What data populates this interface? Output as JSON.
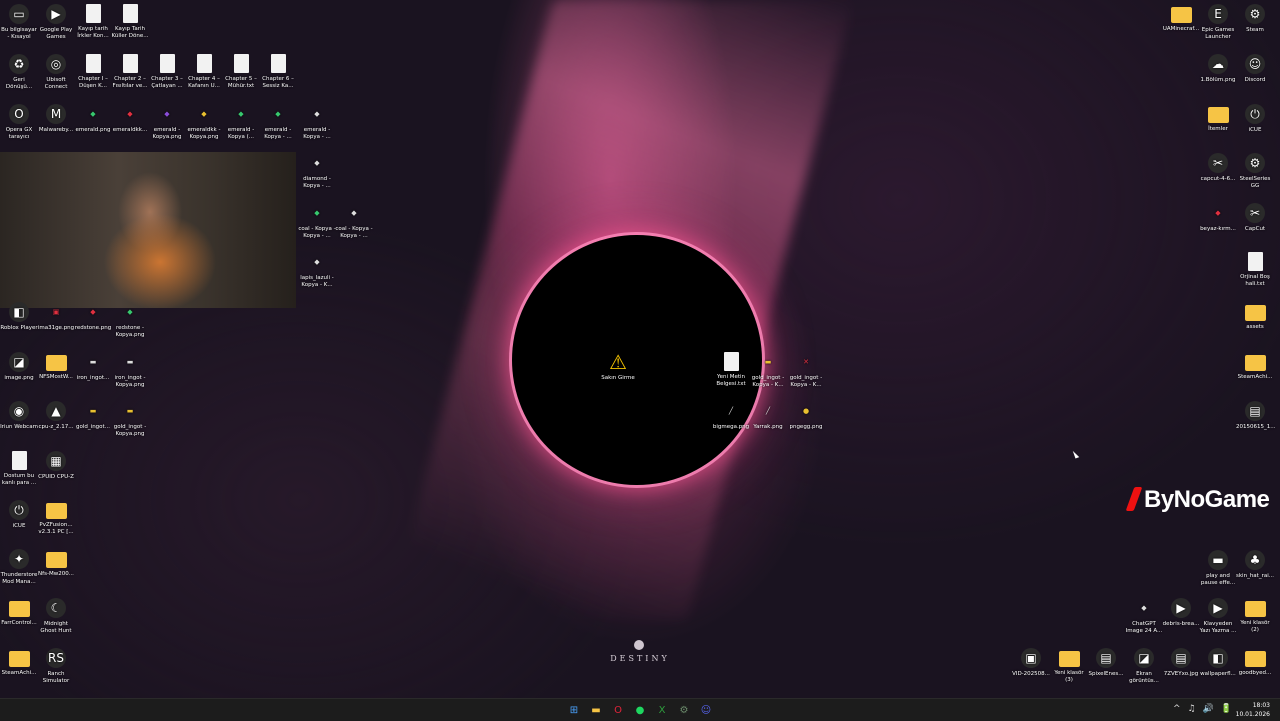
{
  "desktop": {
    "left_icons": [
      {
        "id": "thispc",
        "label": "Bu bilgisayar - Kısayol",
        "kind": "app",
        "glyph": "▭"
      },
      {
        "id": "gplay",
        "label": "Google Play Games",
        "kind": "app",
        "glyph": "▶"
      },
      {
        "id": "kayip1",
        "label": "Kayıp tarih İrkler Kon...",
        "kind": "doc",
        "glyph": ""
      },
      {
        "id": "kayip2",
        "label": "Kayıp Tarih Küller Döne...",
        "kind": "doc",
        "glyph": ""
      },
      {
        "id": "recycle",
        "label": "Geri Dönüşü...",
        "kind": "app",
        "glyph": "♻"
      },
      {
        "id": "ubisoft",
        "label": "Ubisoft Connect",
        "kind": "app",
        "glyph": "◎"
      },
      {
        "id": "ch1",
        "label": "Chapter I – Düşen K...",
        "kind": "doc",
        "glyph": ""
      },
      {
        "id": "ch2",
        "label": "Chapter 2 – Fısıltılar ve...",
        "kind": "doc",
        "glyph": ""
      },
      {
        "id": "ch3",
        "label": "Chapter 3 – Çatlayan ...",
        "kind": "doc",
        "glyph": ""
      },
      {
        "id": "ch4",
        "label": "Chapter 4 – Kafanın U...",
        "kind": "doc",
        "glyph": ""
      },
      {
        "id": "ch5",
        "label": "Chapter 5 – Mühür.txt",
        "kind": "doc",
        "glyph": ""
      },
      {
        "id": "ch6",
        "label": "Chapter 6 – Sessiz Ka...",
        "kind": "doc",
        "glyph": ""
      },
      {
        "id": "operagx",
        "label": "Opera GX tarayıcı",
        "kind": "app",
        "glyph": "O"
      },
      {
        "id": "malwarebytes",
        "label": "Malwareby...",
        "kind": "app",
        "glyph": "M"
      },
      {
        "id": "emerald1",
        "label": "emerald.png",
        "kind": "gem",
        "glyph": "◆"
      },
      {
        "id": "emeralddkk",
        "label": "emeraldkk...",
        "kind": "gem",
        "glyph": "◆",
        "tone": "red"
      },
      {
        "id": "emerald2",
        "label": "emerald - Kopya.png",
        "kind": "gem",
        "glyph": "◆",
        "tone": "purple"
      },
      {
        "id": "emerald3",
        "label": "emeraldkk - Kopya.png",
        "kind": "gem",
        "glyph": "◆",
        "tone": "yellow"
      },
      {
        "id": "emerald4",
        "label": "emerald - Kopya (...",
        "kind": "gem",
        "glyph": "◆"
      },
      {
        "id": "emerald5",
        "label": "emerald - Kopya - ...",
        "kind": "gem",
        "glyph": "◆"
      },
      {
        "id": "emerald6",
        "label": "emerald - Kopya - ...",
        "kind": "gem",
        "glyph": "◆",
        "tone": "white"
      },
      {
        "id": "diamond",
        "label": "diamond - Kopya - ...",
        "kind": "gem",
        "glyph": "◆",
        "tone": "white"
      },
      {
        "id": "coal1",
        "label": "coal - Kopya - Kopya - ...",
        "kind": "gem",
        "glyph": "◆"
      },
      {
        "id": "coal2",
        "label": "coal - Kopya - Kopya - ...",
        "kind": "gem",
        "glyph": "◆",
        "tone": "white"
      },
      {
        "id": "lapis",
        "label": "lapis_lazuli - Kopya - K...",
        "kind": "gem",
        "glyph": "◆",
        "tone": "white"
      },
      {
        "id": "roblox",
        "label": "Roblox Player",
        "kind": "app",
        "glyph": "◧"
      },
      {
        "id": "ima31",
        "label": "ima31ge.png",
        "kind": "gem",
        "glyph": "▣",
        "tone": "red"
      },
      {
        "id": "redstone1",
        "label": "redstone.png",
        "kind": "gem",
        "glyph": "◆",
        "tone": "red"
      },
      {
        "id": "redstone2",
        "label": "redstone - Kopya.png",
        "kind": "gem",
        "glyph": "◆"
      },
      {
        "id": "imagepng",
        "label": "image.png",
        "kind": "app",
        "glyph": "◪"
      },
      {
        "id": "nfsmostw",
        "label": "NFSMostW...",
        "kind": "folder",
        "glyph": ""
      },
      {
        "id": "iron1",
        "label": "iron_ingot...",
        "kind": "gem",
        "glyph": "▬",
        "tone": "white"
      },
      {
        "id": "iron2",
        "label": "iron_ingot - Kopya.png",
        "kind": "gem",
        "glyph": "▬",
        "tone": "white"
      },
      {
        "id": "iriun",
        "label": "Iriun Webcam",
        "kind": "app",
        "glyph": "◉"
      },
      {
        "id": "cpuz217",
        "label": "cpu-z_2.17...",
        "kind": "app",
        "glyph": "▲"
      },
      {
        "id": "gold1",
        "label": "gold_ingot...",
        "kind": "gem",
        "glyph": "▬",
        "tone": "yellow"
      },
      {
        "id": "gold2",
        "label": "gold_ingot - Kopya.png",
        "kind": "gem",
        "glyph": "▬",
        "tone": "yellow"
      },
      {
        "id": "dostum",
        "label": "Dostum bu kanlı para ...",
        "kind": "doc",
        "glyph": ""
      },
      {
        "id": "cpuid",
        "label": "CPUID CPU-Z",
        "kind": "app",
        "glyph": "▦"
      },
      {
        "id": "icue1",
        "label": "iCUE",
        "kind": "app",
        "glyph": "⏻"
      },
      {
        "id": "pvzfusion",
        "label": "PvZFusion... v2.3.1 PC [...",
        "kind": "folder",
        "glyph": ""
      },
      {
        "id": "thunderstore",
        "label": "Thunderstore Mod Mana...",
        "kind": "app",
        "glyph": "✦"
      },
      {
        "id": "nfsmw",
        "label": "Nfs-Mw200...",
        "kind": "folder",
        "glyph": ""
      },
      {
        "id": "farrcontrol",
        "label": "FarrControl...",
        "kind": "folder",
        "glyph": ""
      },
      {
        "id": "midnight",
        "label": "Midnight Ghost Hunt",
        "kind": "app",
        "glyph": "☾"
      },
      {
        "id": "steamachi",
        "label": "SteamAchi...",
        "kind": "folder",
        "glyph": ""
      },
      {
        "id": "ranch",
        "label": "Ranch Simulator",
        "kind": "app",
        "glyph": "RS"
      }
    ],
    "center_icons": [
      {
        "id": "sakin",
        "label": "Sakın Girme",
        "kind": "warn",
        "glyph": "⚠"
      },
      {
        "id": "yenimetin",
        "label": "Yeni Metin Belgesi.txt",
        "kind": "doc",
        "glyph": ""
      },
      {
        "id": "goldk1",
        "label": "gold_ingot - Kopya - K...",
        "kind": "gem",
        "glyph": "▬",
        "tone": "yellow"
      },
      {
        "id": "goldk2",
        "label": "gold_ingot - Kopya - K...",
        "kind": "gem",
        "glyph": "✕",
        "tone": "red"
      },
      {
        "id": "bigmega",
        "label": "bigmega.png",
        "kind": "gem",
        "glyph": "╱",
        "tone": "white"
      },
      {
        "id": "yarrak",
        "label": "Yarrak.png",
        "kind": "gem",
        "glyph": "╱",
        "tone": "white"
      },
      {
        "id": "pngegg",
        "label": "pngegg.png",
        "kind": "gem",
        "glyph": "●",
        "tone": "yellow"
      }
    ],
    "right_icons": [
      {
        "id": "uaminecraft",
        "label": "UAMinecraf...",
        "kind": "folder",
        "glyph": ""
      },
      {
        "id": "epic",
        "label": "Epic Games Launcher",
        "kind": "app",
        "glyph": "E"
      },
      {
        "id": "steam",
        "label": "Steam",
        "kind": "app",
        "glyph": "⚙"
      },
      {
        "id": "bolum1",
        "label": "1.Bölüm.png",
        "kind": "app",
        "glyph": "☁"
      },
      {
        "id": "discord",
        "label": "Discord",
        "kind": "app",
        "glyph": "☺"
      },
      {
        "id": "itemler",
        "label": "İtemler",
        "kind": "folder",
        "glyph": ""
      },
      {
        "id": "icue2",
        "label": "iCUE",
        "kind": "app",
        "glyph": "⏻"
      },
      {
        "id": "capcut46",
        "label": "capcut-4-6...",
        "kind": "app",
        "glyph": "✂"
      },
      {
        "id": "steelseries",
        "label": "SteelSeries GG",
        "kind": "app",
        "glyph": "⚙"
      },
      {
        "id": "beyazkirm",
        "label": "beyaz-kırm...",
        "kind": "gem",
        "glyph": "◆",
        "tone": "red"
      },
      {
        "id": "capcut",
        "label": "CapCut",
        "kind": "app",
        "glyph": "✂"
      },
      {
        "id": "orjinalbos",
        "label": "Orjinal Boş hali.txt",
        "kind": "doc",
        "glyph": ""
      },
      {
        "id": "assets",
        "label": "assets",
        "kind": "folder",
        "glyph": ""
      },
      {
        "id": "steamachi2",
        "label": "SteamAchi...",
        "kind": "folder",
        "glyph": ""
      },
      {
        "id": "file20150615",
        "label": "20150615_1...",
        "kind": "app",
        "glyph": "▤"
      },
      {
        "id": "playpause",
        "label": "play and pause effe...",
        "kind": "app",
        "glyph": "▬"
      },
      {
        "id": "skinhat",
        "label": "skin_hat_rai...",
        "kind": "app",
        "glyph": "♣"
      },
      {
        "id": "chatgpt",
        "label": "ChatGPT Image 24 A...",
        "kind": "gem",
        "glyph": "◆",
        "tone": "white"
      },
      {
        "id": "debris",
        "label": "debris-brea...",
        "kind": "app",
        "glyph": "▶"
      },
      {
        "id": "klavyeden",
        "label": "Klavyeden Yazı Yazma ...",
        "kind": "app",
        "glyph": "▶"
      },
      {
        "id": "yeniklasor2",
        "label": "Yeni klasör (2)",
        "kind": "folder",
        "glyph": ""
      },
      {
        "id": "vid",
        "label": "VID-202508...",
        "kind": "app",
        "glyph": "▣"
      },
      {
        "id": "yeniklasor3",
        "label": "Yeni klasör (3)",
        "kind": "folder",
        "glyph": ""
      },
      {
        "id": "spixel",
        "label": "SpixelEnes...",
        "kind": "app",
        "glyph": "▤"
      },
      {
        "id": "ekran",
        "label": "Ekran görüntüs...",
        "kind": "app",
        "glyph": "◪"
      },
      {
        "id": "zveyxo",
        "label": "7ZVEYxo.jpg",
        "kind": "app",
        "glyph": "▤"
      },
      {
        "id": "wallpaper",
        "label": "wallpaperfl...",
        "kind": "app",
        "glyph": "◧"
      },
      {
        "id": "goodbyed",
        "label": "goodbyed...",
        "kind": "folder",
        "glyph": ""
      }
    ],
    "wallpaper_text": "DESTINY",
    "watermark": "ByNoGame"
  },
  "taskbar": {
    "apps": [
      {
        "id": "start",
        "glyph": "⊞",
        "color": "#4aa3ff"
      },
      {
        "id": "explorer",
        "glyph": "▬",
        "color": "#f6c445"
      },
      {
        "id": "opera",
        "glyph": "O",
        "color": "#e0243a"
      },
      {
        "id": "spotify",
        "glyph": "●",
        "color": "#1ed760"
      },
      {
        "id": "xbox",
        "glyph": "X",
        "color": "#2e9e3e"
      },
      {
        "id": "settings",
        "glyph": "⚙",
        "color": "#6a8a6a"
      },
      {
        "id": "discord",
        "glyph": "☺",
        "color": "#5865f2"
      }
    ],
    "tray_icons": [
      "^",
      "♫",
      "🔊",
      "🔋"
    ],
    "time": "18:03",
    "date": "10.01.2026"
  }
}
